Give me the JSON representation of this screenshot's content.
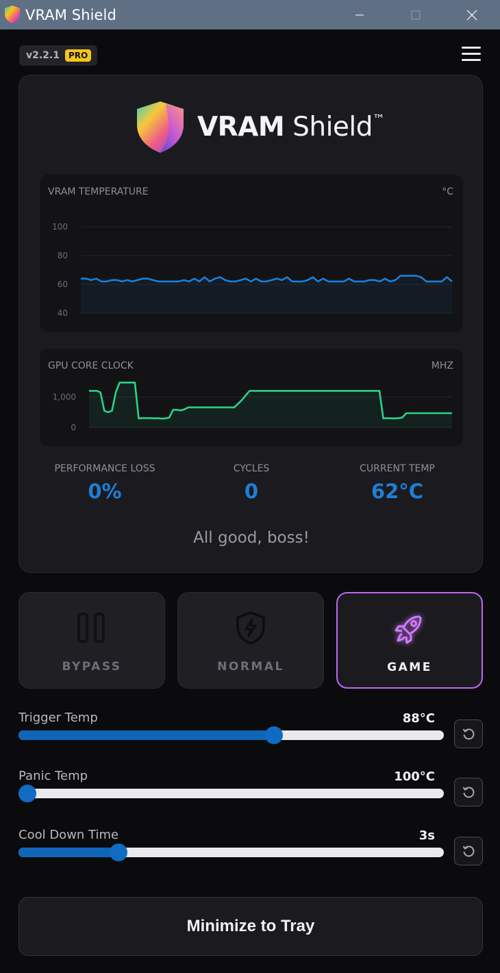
{
  "window": {
    "title": "VRAM Shield",
    "minimize_icon": "minimize-icon",
    "maximize_icon": "maximize-icon",
    "close_icon": "close-icon"
  },
  "header": {
    "version": "v2.2.1",
    "badge": "PRO",
    "menu_icon": "hamburger-menu-icon"
  },
  "brand": {
    "name_bold": "VRAM",
    "name_light": " Shield",
    "trademark": "™"
  },
  "charts": {
    "temperature": {
      "title": "VRAM TEMPERATURE",
      "unit": "°C"
    },
    "clock": {
      "title": "GPU CORE CLOCK",
      "unit": "MHZ"
    }
  },
  "chart_data": [
    {
      "type": "area",
      "title": "VRAM TEMPERATURE",
      "ylabel": "°C",
      "ylim": [
        40,
        100
      ],
      "yticks": [
        "100",
        "80",
        "60",
        "40"
      ],
      "color": "#1b7fd9",
      "grid": true,
      "values": [
        64,
        64,
        63,
        64,
        62,
        62,
        63,
        63,
        62,
        63,
        62,
        63,
        64,
        64,
        63,
        62,
        62,
        62,
        62,
        62,
        63,
        62,
        64,
        62,
        65,
        62,
        64,
        65,
        63,
        62,
        62,
        63,
        64,
        62,
        64,
        62,
        62,
        63,
        64,
        63,
        65,
        62,
        62,
        62,
        63,
        65,
        62,
        64,
        62,
        62,
        62,
        62,
        64,
        62,
        62,
        62,
        63,
        63,
        62,
        64,
        62,
        63,
        66,
        66,
        66,
        66,
        65,
        62,
        62,
        62,
        62,
        65,
        62
      ]
    },
    {
      "type": "area",
      "title": "GPU CORE CLOCK",
      "ylabel": "MHZ",
      "ylim": [
        0,
        1500
      ],
      "yticks": [
        "1,000",
        "0"
      ],
      "color": "#2ad487",
      "grid": true,
      "values": [
        1200,
        1200,
        1200,
        1150,
        550,
        500,
        550,
        1150,
        1470,
        1470,
        1470,
        1470,
        1470,
        300,
        310,
        310,
        310,
        300,
        310,
        290,
        300,
        330,
        580,
        580,
        560,
        600,
        660,
        660,
        660,
        660,
        660,
        660,
        660,
        660,
        660,
        660,
        660,
        660,
        660,
        780,
        900,
        1050,
        1200,
        1200,
        1200,
        1200,
        1200,
        1200,
        1200,
        1200,
        1200,
        1200,
        1200,
        1200,
        1200,
        1200,
        1200,
        1200,
        1200,
        1200,
        1200,
        1200,
        1200,
        1200,
        1200,
        1200,
        1200,
        1200,
        1200,
        1200,
        1200,
        1200,
        1200,
        1200,
        1200,
        1200,
        1200,
        300,
        310,
        300,
        300,
        310,
        330,
        470,
        470,
        470,
        470,
        470,
        470,
        470,
        470,
        470,
        470,
        470,
        470,
        470
      ]
    }
  ],
  "stats": {
    "performance_loss": {
      "label": "PERFORMANCE LOSS",
      "value": "0%"
    },
    "cycles": {
      "label": "CYCLES",
      "value": "0"
    },
    "current_temp": {
      "label": "CURRENT TEMP",
      "value": "62°C"
    }
  },
  "status_message": "All good, boss!",
  "modes": [
    {
      "label": "BYPASS",
      "icon": "pause-icon",
      "active": false
    },
    {
      "label": "NORMAL",
      "icon": "shield-bolt-icon",
      "active": false
    },
    {
      "label": "GAME",
      "icon": "rocket-icon",
      "active": true
    }
  ],
  "sliders": {
    "trigger": {
      "label": "Trigger Temp",
      "value": "88°C",
      "level": 0.6
    },
    "panic": {
      "label": "Panic Temp",
      "value": "100°C",
      "level": 0.02
    },
    "cooldown": {
      "label": "Cool Down Time",
      "value": "3s",
      "level": 0.235
    }
  },
  "reset_icon": "reset-icon",
  "minimize_to_tray": "Minimize to Tray",
  "colors": {
    "accent_blue": "#1d7fd6",
    "game_accent": "#c268f0",
    "pro_badge": "#f5c518",
    "temp_line": "#1b7fd9",
    "clock_line": "#2ad487"
  }
}
